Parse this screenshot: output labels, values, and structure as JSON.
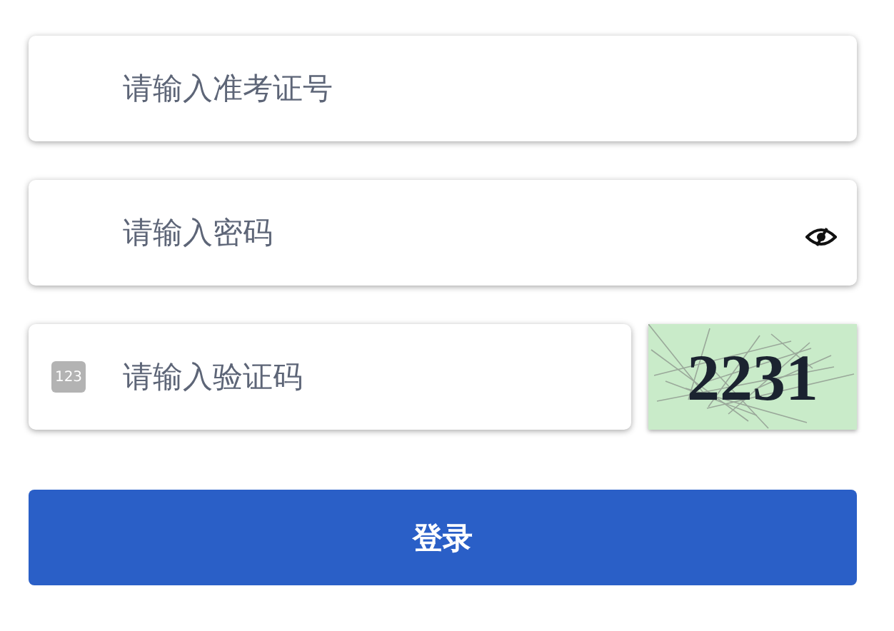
{
  "fields": [
    {
      "kind": "text",
      "placeholder": "请输入准考证号"
    },
    {
      "kind": "password",
      "placeholder": "请输入密码"
    },
    {
      "kind": "captcha",
      "placeholder": "请输入验证码",
      "icon_text": "123",
      "captcha_code": "2231"
    }
  ],
  "submit": {
    "label": "登录"
  }
}
